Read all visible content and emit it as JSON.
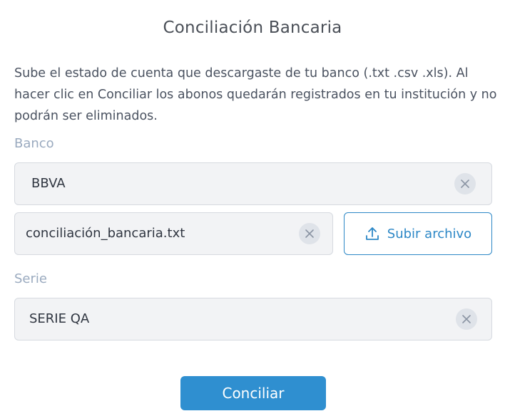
{
  "dialog": {
    "title": "Conciliación Bancaria",
    "description": "Sube el estado de cuenta que descargaste de tu banco (.txt .csv .xls). Al hacer clic en Conciliar los abonos quedarán registrados en tu institución y no podrán ser eliminados."
  },
  "bank": {
    "label": "Banco",
    "value": "BBVA",
    "clear_icon": "close-icon"
  },
  "file": {
    "value": "conciliación_bancaria.txt",
    "clear_icon": "close-icon",
    "upload_label": "Subir archivo",
    "upload_icon": "upload-icon"
  },
  "series": {
    "label": "Serie",
    "value": "SERIE QA",
    "clear_icon": "close-icon"
  },
  "actions": {
    "submit_label": "Conciliar"
  },
  "colors": {
    "accent": "#2c87c6",
    "primary_button": "#2f8fd0",
    "label": "#9aaabf",
    "input_bg": "#f2f3f5"
  }
}
